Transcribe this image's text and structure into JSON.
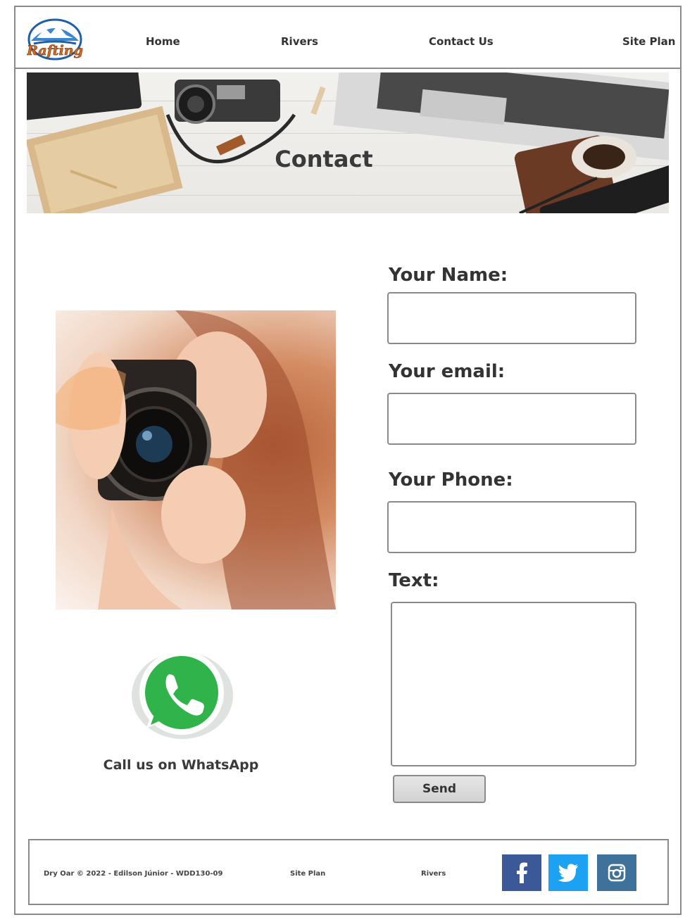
{
  "header": {
    "nav": [
      "Home",
      "Rivers",
      "Contact Us",
      "Site Plan"
    ]
  },
  "banner": {
    "title": "Contact"
  },
  "aside": {
    "whatsapp_label": "Call us on WhatsApp"
  },
  "form": {
    "name_label": "Your Name:",
    "name_value": "",
    "email_label": "Your email:",
    "email_value": "",
    "phone_label": "Your Phone:",
    "phone_value": "",
    "text_label": "Text:",
    "text_value": "",
    "send_label": "Send"
  },
  "footer": {
    "copyright": "Dry Oar © 2022 - Edilson Júnior - WDD130-09",
    "site_plan": "Site Plan",
    "rivers": "Rivers",
    "social": [
      {
        "icon": "facebook-icon",
        "color": "#3b5998"
      },
      {
        "icon": "twitter-icon",
        "color": "#1da1f2"
      },
      {
        "icon": "instagram-icon",
        "color": "#3f729b"
      }
    ]
  },
  "colors": {
    "border": "#8a8a8a",
    "text": "#333333"
  },
  "logo_text": "Rafting"
}
